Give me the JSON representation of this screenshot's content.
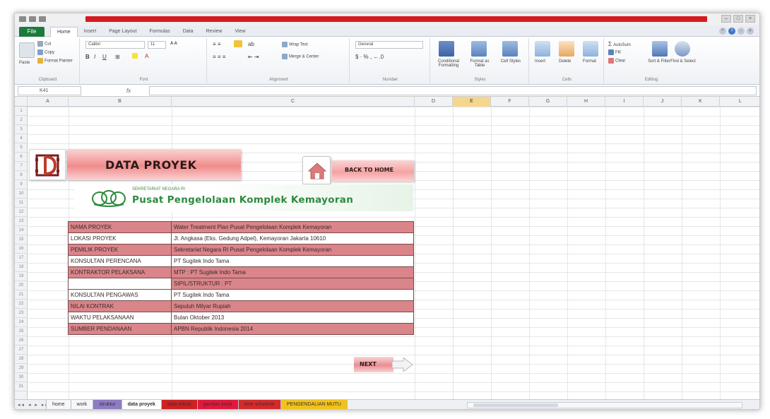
{
  "ribbon": {
    "file_tab": "File",
    "tabs": [
      "Home",
      "Insert",
      "Page Layout",
      "Formulas",
      "Data",
      "Review",
      "View"
    ],
    "clipboard": {
      "cut": "Cut",
      "copy": "Copy",
      "paste": "Paste",
      "format_painter": "Format Painter",
      "label": "Clipboard"
    },
    "font": {
      "name": "Calibri",
      "size": "11",
      "label": "Font"
    },
    "alignment": {
      "wrap_text": "Wrap Text",
      "merge": "Merge & Center",
      "label": "Alignment"
    },
    "number": {
      "format": "General",
      "label": "Number"
    },
    "styles": {
      "conditional": "Conditional Formatting",
      "format_table": "Format as Table",
      "cell_styles": "Cell Styles",
      "label": "Styles"
    },
    "cells": {
      "insert": "Insert",
      "delete": "Delete",
      "format": "Format",
      "label": "Cells"
    },
    "editing": {
      "autosum": "AutoSum",
      "fill": "Fill",
      "clear": "Clear",
      "sort_filter": "Sort & Filter",
      "find_select": "Find & Select",
      "label": "Editing"
    }
  },
  "formula_bar": {
    "name_box": "K41",
    "fx": "fx",
    "value": ""
  },
  "columns": [
    "A",
    "B",
    "C",
    "D",
    "E",
    "F",
    "G",
    "H",
    "I",
    "J",
    "K",
    "L"
  ],
  "selected_column": "E",
  "rows": [
    "1",
    "2",
    "3",
    "4",
    "5",
    "6",
    "7",
    "8",
    "9",
    "10",
    "11",
    "12",
    "13",
    "14",
    "15",
    "16",
    "17",
    "18",
    "19",
    "20",
    "21",
    "22",
    "23",
    "24",
    "25",
    "26",
    "27",
    "28",
    "29",
    "30",
    "31"
  ],
  "sheet": {
    "title": "DATA PROYEK",
    "back_button": "BACK TO HOME",
    "org_subtitle": "SEKRETARIAT NEGARA RI",
    "org_name": "Pusat Pengelolaan Komplek Kemayoran",
    "next_button": "NEXT",
    "table": [
      {
        "key": "NAMA PROYEK",
        "value": "Water Treatment Plan Pusat Pengelolaan Komplek Kemayoran"
      },
      {
        "key": "LOKASI PROYEK",
        "value": "Jl. Angkasa (Eks. Gedung Adpel), Kemayoran Jakarta 10610"
      },
      {
        "key": "PEMILIK PROYEK",
        "value": "Sekretariat Negara RI Pusat Pengelolaan Komplek Kemayoran"
      },
      {
        "key": "KONSULTAN PERENCANA",
        "value": "PT Sugitek Indo Tama"
      },
      {
        "key": "KONTRAKTOR PELAKSANA",
        "value": "MTP : PT Sugitek Indo Tama"
      },
      {
        "key": "",
        "value": "SIPIL/STRUKTUR : PT"
      },
      {
        "key": "KONSULTAN PENGAWAS",
        "value": "PT Sugitek Indo Tama"
      },
      {
        "key": "NILAI KONTRAK",
        "value": "Sepuluh Milyar Rupiah"
      },
      {
        "key": "WAKTU PELAKSANAAN",
        "value": "Bulan Oktober 2013"
      },
      {
        "key": "SUMBER PENDANAAN",
        "value": "APBN Republik Indonesia 2014"
      }
    ]
  },
  "sheet_tabs": [
    {
      "label": "home",
      "color": "#f6f7f9"
    },
    {
      "label": "work",
      "color": "#f6f7f9"
    },
    {
      "label": "struktur",
      "color": "#8e7cc3"
    },
    {
      "label": "data proyek",
      "color": "#ffffff"
    },
    {
      "label": "data teknis",
      "color": "#cc2222"
    },
    {
      "label": "gambar kerja",
      "color": "#e0193c"
    },
    {
      "label": "time schedule",
      "color": "#d62a2a"
    },
    {
      "label": "PENGENDALIAN MUTU",
      "color": "#f3c21a"
    }
  ],
  "colors": {
    "accent_red": "#d71920",
    "excel_green": "#1e7a3a",
    "pink": "#d9858a",
    "org_green": "#2d8a3e"
  }
}
